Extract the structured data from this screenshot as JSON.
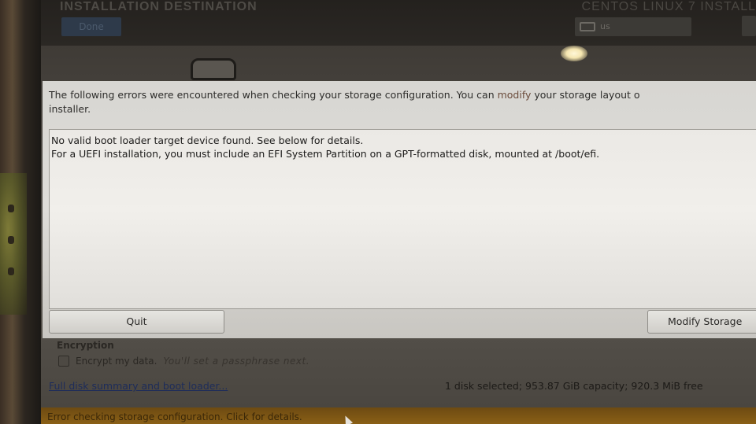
{
  "header": {
    "title": "INSTALLATION DESTINATION",
    "done_label": "Done",
    "product": "CENTOS LINUX 7 INSTALL",
    "keyboard_layout": "us"
  },
  "dialog": {
    "message_before": "The following errors were encountered when checking your storage configuration.  You can ",
    "message_link": "modify",
    "message_after": " your storage layout o",
    "message_line2": "installer.",
    "details": [
      "No valid boot loader target device found. See below for details.",
      "For a UEFI installation, you must include an EFI System Partition on a GPT-formatted disk, mounted at /boot/efi."
    ],
    "quit_label": "Quit",
    "modify_label": "Modify Storage"
  },
  "encryption": {
    "heading": "Encryption",
    "checkbox_label": "Encrypt my data.",
    "hint": "You'll set a passphrase next."
  },
  "footer": {
    "summary_link": "Full disk summary and boot loader...",
    "disk_summary": "1 disk selected; 953.87 GiB capacity; 920.3 MiB free"
  },
  "warning": {
    "text": "Error checking storage configuration.  Click for details."
  },
  "colors": {
    "dialog_bg": "#dedcd8",
    "link": "#1d2c5a",
    "warning_bar": "#8a5f16"
  }
}
